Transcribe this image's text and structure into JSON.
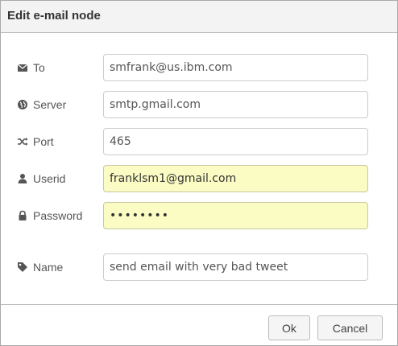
{
  "dialog": {
    "title": "Edit e-mail node"
  },
  "fields": {
    "to": {
      "label": "To",
      "icon": "envelope-icon",
      "value": "smfrank@us.ibm.com"
    },
    "server": {
      "label": "Server",
      "icon": "globe-icon",
      "value": "smtp.gmail.com"
    },
    "port": {
      "label": "Port",
      "icon": "random-icon",
      "value": "465"
    },
    "userid": {
      "label": "Userid",
      "icon": "user-icon",
      "value": "franklsm1@gmail.com"
    },
    "password": {
      "label": "Password",
      "icon": "lock-icon",
      "value": "••••••••"
    },
    "name": {
      "label": "Name",
      "icon": "tag-icon",
      "value": "send email with very bad tweet"
    }
  },
  "buttons": {
    "ok": "Ok",
    "cancel": "Cancel"
  },
  "colors": {
    "autofill": "#fafcc4",
    "titlebar": "#f3f3f3"
  }
}
